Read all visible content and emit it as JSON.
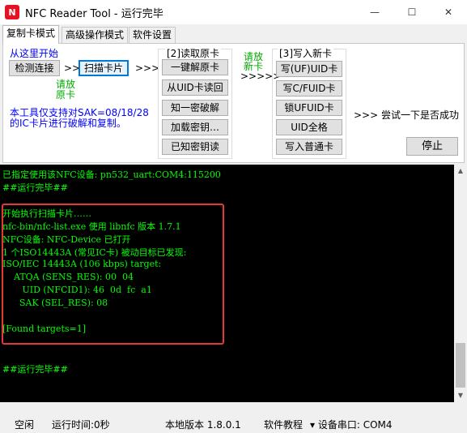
{
  "window": {
    "app_icon": "N",
    "title": "NFC Reader Tool - 运行完毕",
    "minimize": "—",
    "maximize": "☐",
    "close": "✕"
  },
  "tabs": [
    {
      "label": "复制卡模式",
      "active": true
    },
    {
      "label": "高级操作模式",
      "active": false
    },
    {
      "label": "软件设置",
      "active": false
    }
  ],
  "copy_panel": {
    "start_here": "从这里开始",
    "detect_button": "检测连接",
    "arrow_1": ">>",
    "scan_button": "扫描卡片",
    "arrow_2": ">>>",
    "hint_place_card_1": "请放",
    "hint_place_card_2": "原卡",
    "info_line_1": "本工具仅支持对SAK=08/18/28",
    "info_line_2": "的IC卡片进行破解和复制。",
    "read_group": {
      "title": "[2]读取原卡",
      "buttons": [
        "一键解原卡",
        "从UID卡读回",
        "知一密破解",
        "加载密钥…",
        "已知密钥读"
      ]
    },
    "place_new_card": [
      "请放",
      "新卡"
    ],
    "arrow_3": ">>>>>",
    "write_group": {
      "title": "[3]写入新卡",
      "buttons": [
        "写(UF)UID卡",
        "写C/FUID卡",
        "锁UFUID卡",
        "UID全格",
        "写入普通卡"
      ]
    },
    "try_hint": ">>> 尝试一下是否成功",
    "stop_button": "停止"
  },
  "console": {
    "lines": [
      "已指定使用该NFC设备: pn532_uart:COM4:115200",
      "##运行完毕##",
      "",
      "开始执行扫描卡片……",
      "nfc-bin/nfc-list.exe 使用 libnfc 版本 1.7.1",
      "NFC设备: NFC-Device 已打开",
      "1 个ISO14443A (常见IC卡) 被动目标已发现:",
      "ISO/IEC 14443A (106 kbps) target:",
      "    ATQA (SENS_RES): 00  04",
      "       UID (NFCID1): 46  0d  fc  a1",
      "      SAK (SEL_RES): 08",
      "",
      "[Found targets=1]",
      "",
      "",
      "##运行完毕##"
    ]
  },
  "scrollbar": {
    "up": "▲",
    "down": "▼"
  },
  "status": {
    "state": "空闲",
    "runtime": "运行时间:0秒",
    "version": "本地版本 1.8.0.1",
    "tutorial": "软件教程",
    "port": "▾ 设备串口: COM4"
  }
}
